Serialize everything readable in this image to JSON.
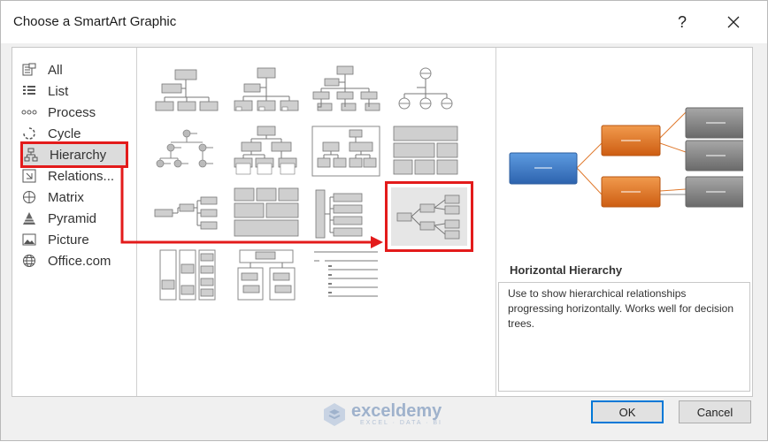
{
  "window": {
    "title": "Choose a SmartArt Graphic",
    "help_label": "?",
    "close_label": "✕"
  },
  "categories": [
    {
      "label": "All",
      "icon": "all-icon"
    },
    {
      "label": "List",
      "icon": "list-icon"
    },
    {
      "label": "Process",
      "icon": "process-icon"
    },
    {
      "label": "Cycle",
      "icon": "cycle-icon"
    },
    {
      "label": "Hierarchy",
      "icon": "hierarchy-icon",
      "selected": true
    },
    {
      "label": "Relations...",
      "icon": "relationship-icon"
    },
    {
      "label": "Matrix",
      "icon": "matrix-icon"
    },
    {
      "label": "Pyramid",
      "icon": "pyramid-icon"
    },
    {
      "label": "Picture",
      "icon": "picture-icon"
    },
    {
      "label": "Office.com",
      "icon": "globe-icon"
    }
  ],
  "gallery": {
    "selected_layout": "Horizontal Hierarchy",
    "layout_count": 15
  },
  "preview": {
    "title": "Horizontal Hierarchy",
    "description": "Use to show hierarchical relationships progressing horizontally. Works well for decision trees.",
    "colors": {
      "root": "#3d7cc9",
      "level2": "#e07a2e",
      "level3": "#8a8a8a"
    }
  },
  "buttons": {
    "ok_label": "OK",
    "cancel_label": "Cancel"
  },
  "watermark": {
    "name": "exceldemy",
    "tagline": "EXCEL · DATA · BI"
  },
  "colors": {
    "highlight": "#e31b1b",
    "ok_border": "#0078d7"
  }
}
